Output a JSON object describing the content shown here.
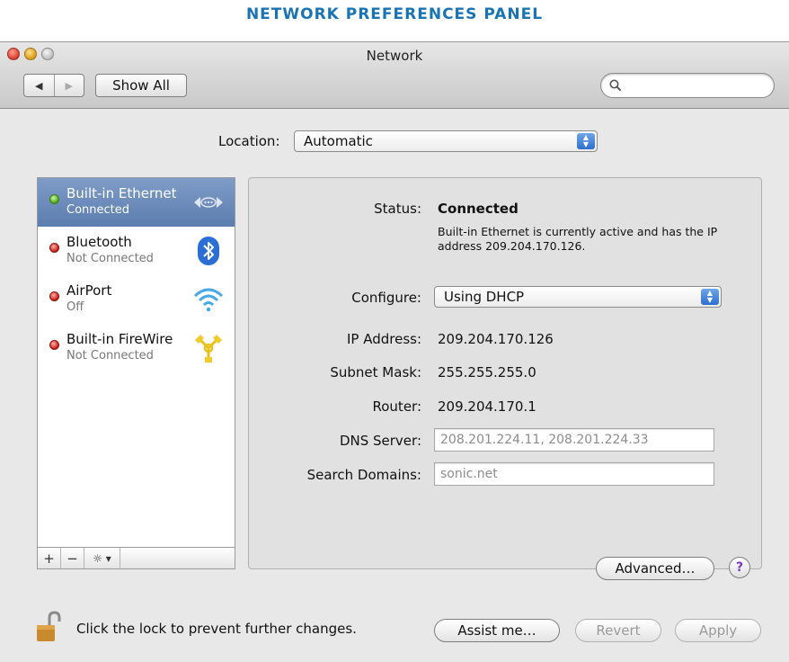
{
  "heading": "NETWORK PREFERENCES PANEL",
  "window": {
    "title": "Network"
  },
  "toolbar": {
    "back_glyph": "◀",
    "forward_glyph": "▶",
    "show_all_label": "Show All",
    "search_value": ""
  },
  "location": {
    "label": "Location:",
    "value": "Automatic"
  },
  "services": [
    {
      "name": "Built-in Ethernet",
      "status": "Connected",
      "indicator": "green",
      "icon": "ethernet-icon",
      "selected": true
    },
    {
      "name": "Bluetooth",
      "status": "Not Connected",
      "indicator": "red",
      "icon": "bluetooth-icon",
      "selected": false
    },
    {
      "name": "AirPort",
      "status": "Off",
      "indicator": "red",
      "icon": "wifi-icon",
      "selected": false
    },
    {
      "name": "Built-in FireWire",
      "status": "Not Connected",
      "indicator": "red",
      "icon": "firewire-icon",
      "selected": false
    }
  ],
  "sidebar_controls": {
    "add": "+",
    "remove": "−",
    "action": "☼ ▾"
  },
  "detail": {
    "status_label": "Status:",
    "status_value": "Connected",
    "status_description": "Built-in Ethernet is currently active and has the IP address 209.204.170.126.",
    "configure_label": "Configure:",
    "configure_value": "Using DHCP",
    "ip_label": "IP Address:",
    "ip_value": "209.204.170.126",
    "subnet_label": "Subnet Mask:",
    "subnet_value": "255.255.255.0",
    "router_label": "Router:",
    "router_value": "209.204.170.1",
    "dns_label": "DNS Server:",
    "dns_value": "208.201.224.11, 208.201.224.33",
    "search_domains_label": "Search Domains:",
    "search_domains_value": "sonic.net",
    "advanced_label": "Advanced…",
    "help_label": "?"
  },
  "footer": {
    "lock_text": "Click the lock to prevent further changes.",
    "assist_label": "Assist me…",
    "revert_label": "Revert",
    "apply_label": "Apply"
  },
  "colors": {
    "heading": "#1a73b5",
    "selection": "#6a88ba",
    "connected": "#4aa614",
    "not_connected": "#c61b12",
    "popup_stepper": "#2d6ed0"
  }
}
